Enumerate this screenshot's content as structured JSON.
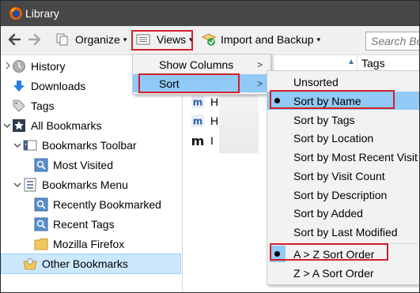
{
  "window": {
    "title": "Library"
  },
  "toolbar": {
    "organize_label": "Organize",
    "views_label": "Views",
    "import_label": "Import and Backup",
    "search_placeholder": "Search Bookmarks"
  },
  "sidebar": {
    "items": [
      {
        "label": "History"
      },
      {
        "label": "Downloads"
      },
      {
        "label": "Tags"
      },
      {
        "label": "All Bookmarks"
      },
      {
        "label": "Bookmarks Toolbar"
      },
      {
        "label": "Most Visited"
      },
      {
        "label": "Bookmarks Menu"
      },
      {
        "label": "Recently Bookmarked"
      },
      {
        "label": "Recent Tags"
      },
      {
        "label": "Mozilla Firefox"
      },
      {
        "label": "Other Bookmarks"
      }
    ]
  },
  "content": {
    "columns": {
      "tags": "Tags"
    },
    "rows": [
      {
        "text": "H"
      },
      {
        "text": "H"
      },
      {
        "text": "I"
      }
    ]
  },
  "views_menu": {
    "items": [
      {
        "label": "Show Columns"
      },
      {
        "label": "Sort"
      }
    ]
  },
  "sort_menu": {
    "items": [
      {
        "label": "Unsorted"
      },
      {
        "label": "Sort by Name"
      },
      {
        "label": "Sort by Tags"
      },
      {
        "label": "Sort by Location"
      },
      {
        "label": "Sort by Most Recent Visit"
      },
      {
        "label": "Sort by Visit Count"
      },
      {
        "label": "Sort by Description"
      },
      {
        "label": "Sort by Added"
      },
      {
        "label": "Sort by Last Modified"
      },
      {
        "label": "A > Z Sort Order"
      },
      {
        "label": "Z > A Sort Order"
      }
    ]
  },
  "colors": {
    "titlebar": "#474747",
    "highlight": "#91c9f7",
    "selection": "#cce8ff",
    "annotation_red": "#d0202a"
  }
}
